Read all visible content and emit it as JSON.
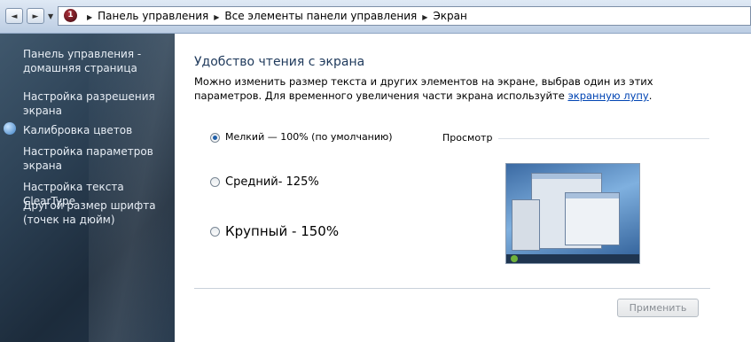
{
  "address_bar": {
    "breadcrumbs": [
      "Панель управления",
      "Все элементы панели управления",
      "Экран"
    ]
  },
  "sidebar": {
    "items": [
      {
        "label": "Панель управления - домашняя страница"
      },
      {
        "label": "Настройка разрешения экрана"
      },
      {
        "label": "Калибровка цветов"
      },
      {
        "label": "Настройка параметров экрана"
      },
      {
        "label": "Настройка текста ClearType"
      },
      {
        "label": "Другой размер шрифта (точек на дюйм)"
      }
    ]
  },
  "main": {
    "title": "Удобство чтения с экрана",
    "description": "Можно изменить размер текста и других элементов на экране, выбрав один из этих параметров. Для временного увеличения части экрана используйте ",
    "link_text": "экранную лупу",
    "description_end": ".",
    "options": [
      {
        "label": "Мелкий — 100% (по умолчанию)",
        "checked": true
      },
      {
        "label": "Средний- 125%",
        "checked": false
      },
      {
        "label": "Крупный - 150%",
        "checked": false
      }
    ],
    "preview_label": "Просмотр",
    "apply_label": "Применить"
  },
  "colors": {
    "link": "#0044b3",
    "title": "#1e395b",
    "sidebar_bg": "#2d4256"
  }
}
